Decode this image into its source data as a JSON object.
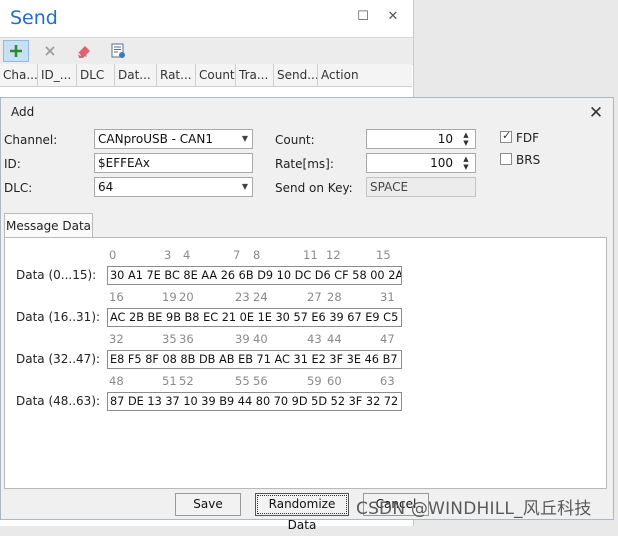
{
  "send_panel": {
    "title": "Send",
    "columns": [
      "Cha...",
      "ID_...",
      "DLC",
      "Dat...",
      "Rat...",
      "Count",
      "Tra...",
      "Send...",
      "Action"
    ]
  },
  "dialog": {
    "title": "Add",
    "channel_label": "Channel:",
    "channel_value": "CANproUSB - CAN1",
    "id_label": "ID:",
    "id_value": "$EFFEAx",
    "dlc_label": "DLC:",
    "dlc_value": "64",
    "count_label": "Count:",
    "count_value": "10",
    "rate_label": "Rate[ms]:",
    "rate_value": "100",
    "send_key_label": "Send on Key:",
    "send_key_value": "SPACE",
    "fdf_label": "FDF",
    "fdf_checked": true,
    "brs_label": "BRS",
    "brs_checked": false,
    "tab_label": "Message Data",
    "rows": [
      {
        "label": "Data (0...15):",
        "idx": [
          "0",
          "3",
          "4",
          "7",
          "8",
          "11",
          "12",
          "15"
        ],
        "hex": "30 A1 7E BC 8E AA 26 6B D9 10 DC D6 CF 58 00 2A"
      },
      {
        "label": "Data (16..31):",
        "idx": [
          "16",
          "19",
          "20",
          "23",
          "24",
          "27",
          "28",
          "31"
        ],
        "hex": "AC 2B BE 9B B8 EC 21 0E 1E 30 57 E6 39 67 E9 C5"
      },
      {
        "label": "Data (32..47):",
        "idx": [
          "32",
          "35",
          "36",
          "39",
          "40",
          "43",
          "44",
          "47"
        ],
        "hex": "E8 F5 8F 08 8B DB AB EB 71 AC 31 E2 3F 3E 46 B7"
      },
      {
        "label": "Data (48..63):",
        "idx": [
          "48",
          "51",
          "52",
          "55",
          "56",
          "59",
          "60",
          "63"
        ],
        "hex": "87 DE 13 37 10 39 B9 44 80 70 9D 5D 52 3F 32 72"
      }
    ],
    "save_label": "Save",
    "randomize_label": "Randomize Data",
    "cancel_label": "Cancel"
  },
  "watermark": "CSDN @WINDHILL_风丘科技"
}
